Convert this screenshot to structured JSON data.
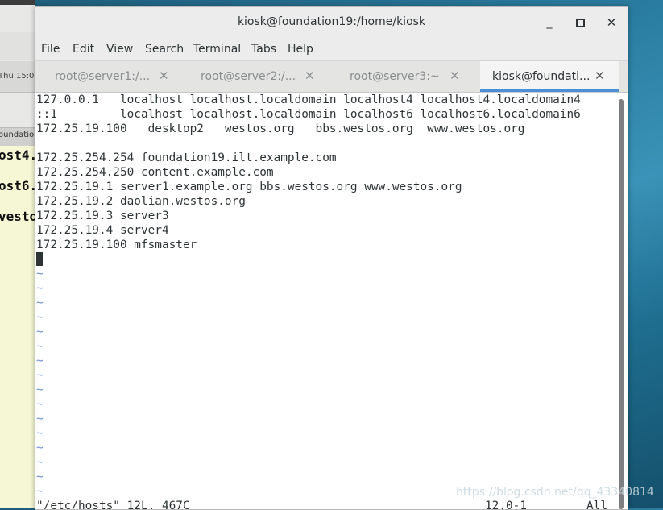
{
  "background_window": {
    "time_text": "Thu 15:0",
    "tab_text": "oundation",
    "lines": [
      "ost4.",
      "ost6.",
      "vesto"
    ]
  },
  "window": {
    "title": "kiosk@foundation19:/home/kiosk",
    "minimize_glyph": "_",
    "close_glyph": "✕"
  },
  "menubar": [
    "File",
    "Edit",
    "View",
    "Search",
    "Terminal",
    "Tabs",
    "Help"
  ],
  "tabs": [
    {
      "label": "root@server1:/...",
      "active": false
    },
    {
      "label": "root@server2:/...",
      "active": false
    },
    {
      "label": "root@server3:~",
      "active": false
    },
    {
      "label": "kiosk@foundati...",
      "active": true
    }
  ],
  "tab_close_glyph": "✕",
  "terminal": {
    "lines": [
      "127.0.0.1   localhost localhost.localdomain localhost4 localhost4.localdomain4",
      "::1         localhost localhost.localdomain localhost6 localhost6.localdomain6",
      "172.25.19.100   desktop2   westos.org   bbs.westos.org  www.westos.org",
      "",
      "172.25.254.254 foundation19.ilt.example.com",
      "172.25.254.250 content.example.com",
      "172.25.19.1 server1.example.org bbs.westos.org www.westos.org",
      "172.25.19.2 daolian.westos.org",
      "172.25.19.3 server3",
      "172.25.19.4 server4",
      "172.25.19.100 mfsmaster"
    ],
    "tilde": "~",
    "status": {
      "file": "\"/etc/hosts\" 12L, 467C",
      "position": "12,0-1",
      "scroll": "All"
    }
  },
  "watermark": "https://blog.csdn.net/qq_43340814"
}
